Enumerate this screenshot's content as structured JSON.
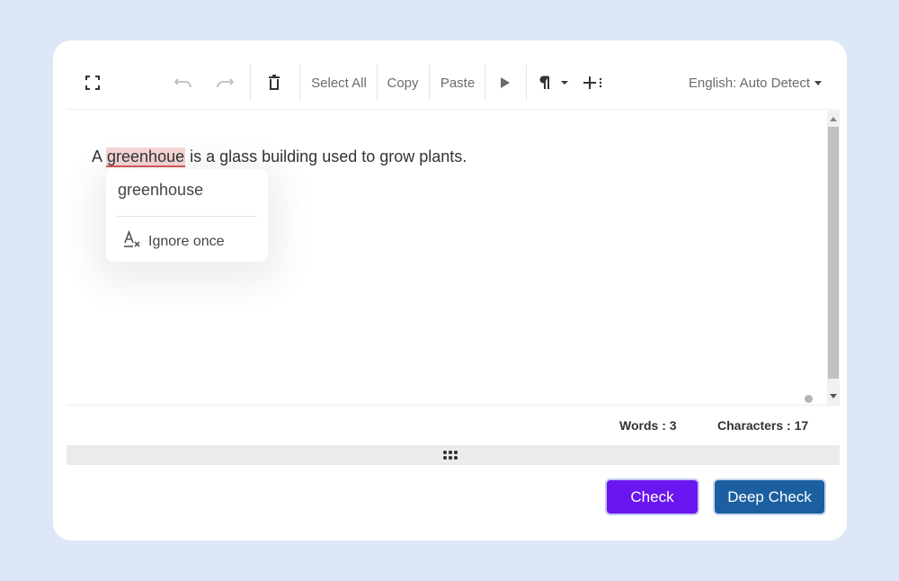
{
  "toolbar": {
    "select_all": "Select All",
    "copy": "Copy",
    "paste": "Paste",
    "language": "English: Auto Detect"
  },
  "editor": {
    "prefix": "A ",
    "misspelled_word": "greenhoue",
    "suffix": " is a glass building used to grow plants."
  },
  "popup": {
    "suggestion": "greenhouse",
    "ignore_label": "Ignore once"
  },
  "stats": {
    "words": "Words : 3",
    "characters": "Characters : 17"
  },
  "buttons": {
    "check": "Check",
    "deep_check": "Deep Check"
  },
  "colors": {
    "check_button": "#6a16f0",
    "deep_check_button": "#1b5fa0",
    "misspelled_highlight": "#f6d6d6",
    "background": "#dde7f8"
  },
  "icons": [
    "fullscreen-icon",
    "undo-icon",
    "redo-icon",
    "trash-icon",
    "play-icon",
    "paragraph-icon",
    "insert-icon",
    "clear-format-icon",
    "grip-icon"
  ]
}
